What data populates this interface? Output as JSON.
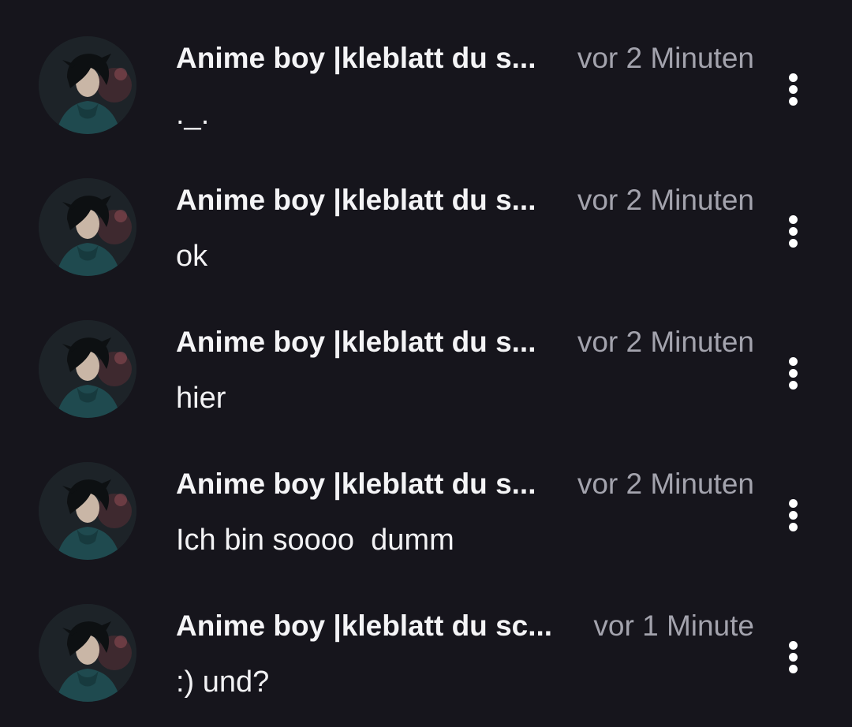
{
  "colors": {
    "background": "#16151c",
    "author_text": "#f4f4f6",
    "timestamp_text": "#a3a3ad",
    "message_text": "#f2f2f4",
    "menu_icon": "#ffffff"
  },
  "comments": [
    {
      "author": "Anime boy |kleblatt du s...",
      "time": "vor 2 Minuten",
      "text": "._.",
      "avatar_icon": "anime-boy-avatar",
      "menu_icon": "more-vertical-icon"
    },
    {
      "author": "Anime boy |kleblatt du s...",
      "time": "vor 2 Minuten",
      "text": "ok",
      "avatar_icon": "anime-boy-avatar",
      "menu_icon": "more-vertical-icon"
    },
    {
      "author": "Anime boy |kleblatt du s...",
      "time": "vor 2 Minuten",
      "text": "hier",
      "avatar_icon": "anime-boy-avatar",
      "menu_icon": "more-vertical-icon"
    },
    {
      "author": "Anime boy |kleblatt du s...",
      "time": "vor 2 Minuten",
      "text": "Ich bin soooo  dumm",
      "avatar_icon": "anime-boy-avatar",
      "menu_icon": "more-vertical-icon"
    },
    {
      "author": "Anime boy |kleblatt du sc...",
      "time": "vor 1 Minute",
      "text": ":) und?",
      "avatar_icon": "anime-boy-avatar",
      "menu_icon": "more-vertical-icon"
    }
  ]
}
